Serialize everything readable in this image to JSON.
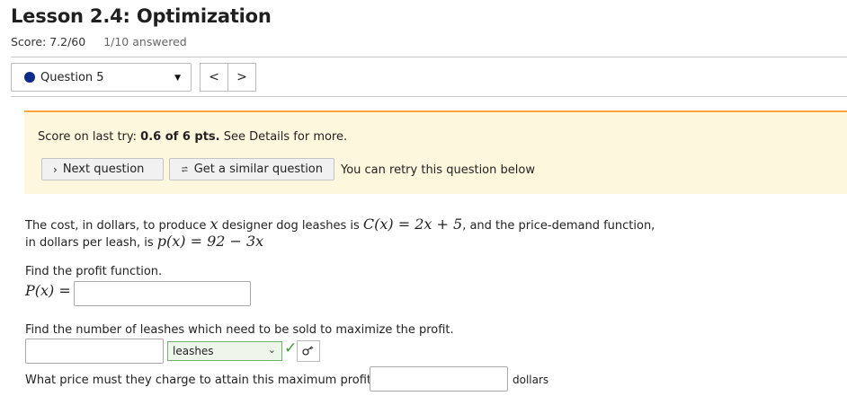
{
  "header": {
    "title": "Lesson 2.4: Optimization",
    "score": "Score: 7.2/60",
    "answered": "1/10 answered"
  },
  "question_nav": {
    "selected": "Question 5",
    "prev": "<",
    "next": ">"
  },
  "alert": {
    "pre": "Score on last try: ",
    "score": "0.6 of 6 pts.",
    "post": " See Details for more.",
    "next_button": "Next question",
    "similar_button": "Get a similar question",
    "retry_text": "You can retry this question below"
  },
  "problem": {
    "line1_a": "The cost, in dollars, to produce ",
    "line1_b": " designer dog leashes is ",
    "line1_c": ", and the price-demand function,",
    "line2_a": "in dollars per leash, is ",
    "cost_fn": "C(x) = 2x + 5",
    "price_fn": "p(x) = 92 − 3x",
    "var": "x",
    "q1": "Find the profit function.",
    "q1_label": "P(x) =",
    "q1_value": "",
    "q2": "Find the number of leashes which need to be sold to maximize the profit.",
    "q2_value": "",
    "q2_unit_selected": "leashes",
    "q3": "What price must they charge to attain this maximum profit?",
    "q3_value": "",
    "q3_unit": "dollars"
  },
  "colors": {
    "alert_bg": "#fdf7dd",
    "alert_border": "#f3a43b",
    "question_dot": "#0a2a8c",
    "correct": "#3a9a2f"
  },
  "icons": {
    "next": "chevron-right-icon",
    "similar": "refresh-icon",
    "key": "key-icon",
    "check": "checkmark-icon"
  }
}
